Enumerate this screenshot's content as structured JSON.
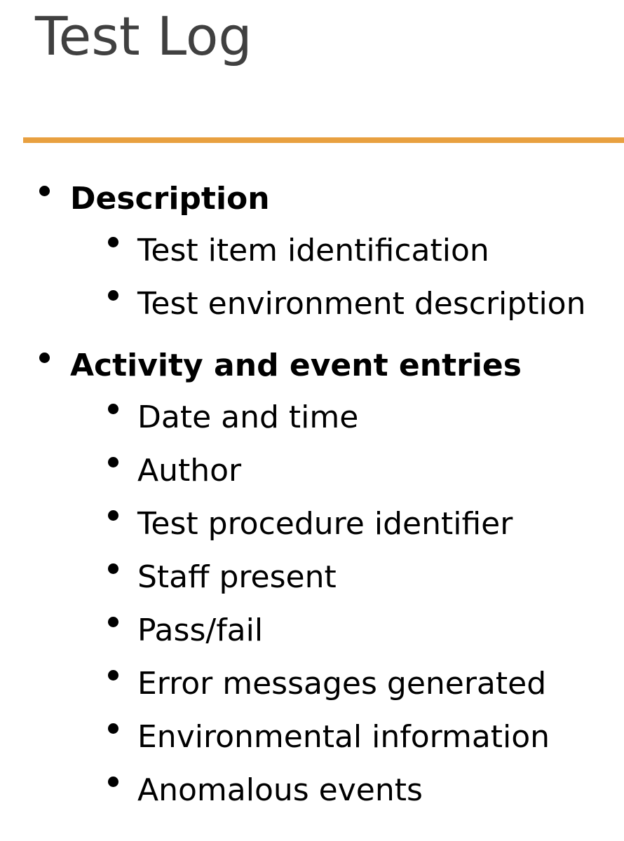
{
  "title": "Test Log",
  "colors": {
    "accent_rule": "#e8a040",
    "title": "#404040",
    "text": "#000000"
  },
  "sections": [
    {
      "label": "Description",
      "items": [
        "Test item identification",
        "Test environment description"
      ]
    },
    {
      "label": "Activity and event entries",
      "items": [
        "Date and time",
        "Author",
        "Test procedure identifier",
        "Staff present",
        "Pass/fail",
        "Error messages generated",
        "Environmental information",
        "Anomalous events"
      ]
    }
  ]
}
